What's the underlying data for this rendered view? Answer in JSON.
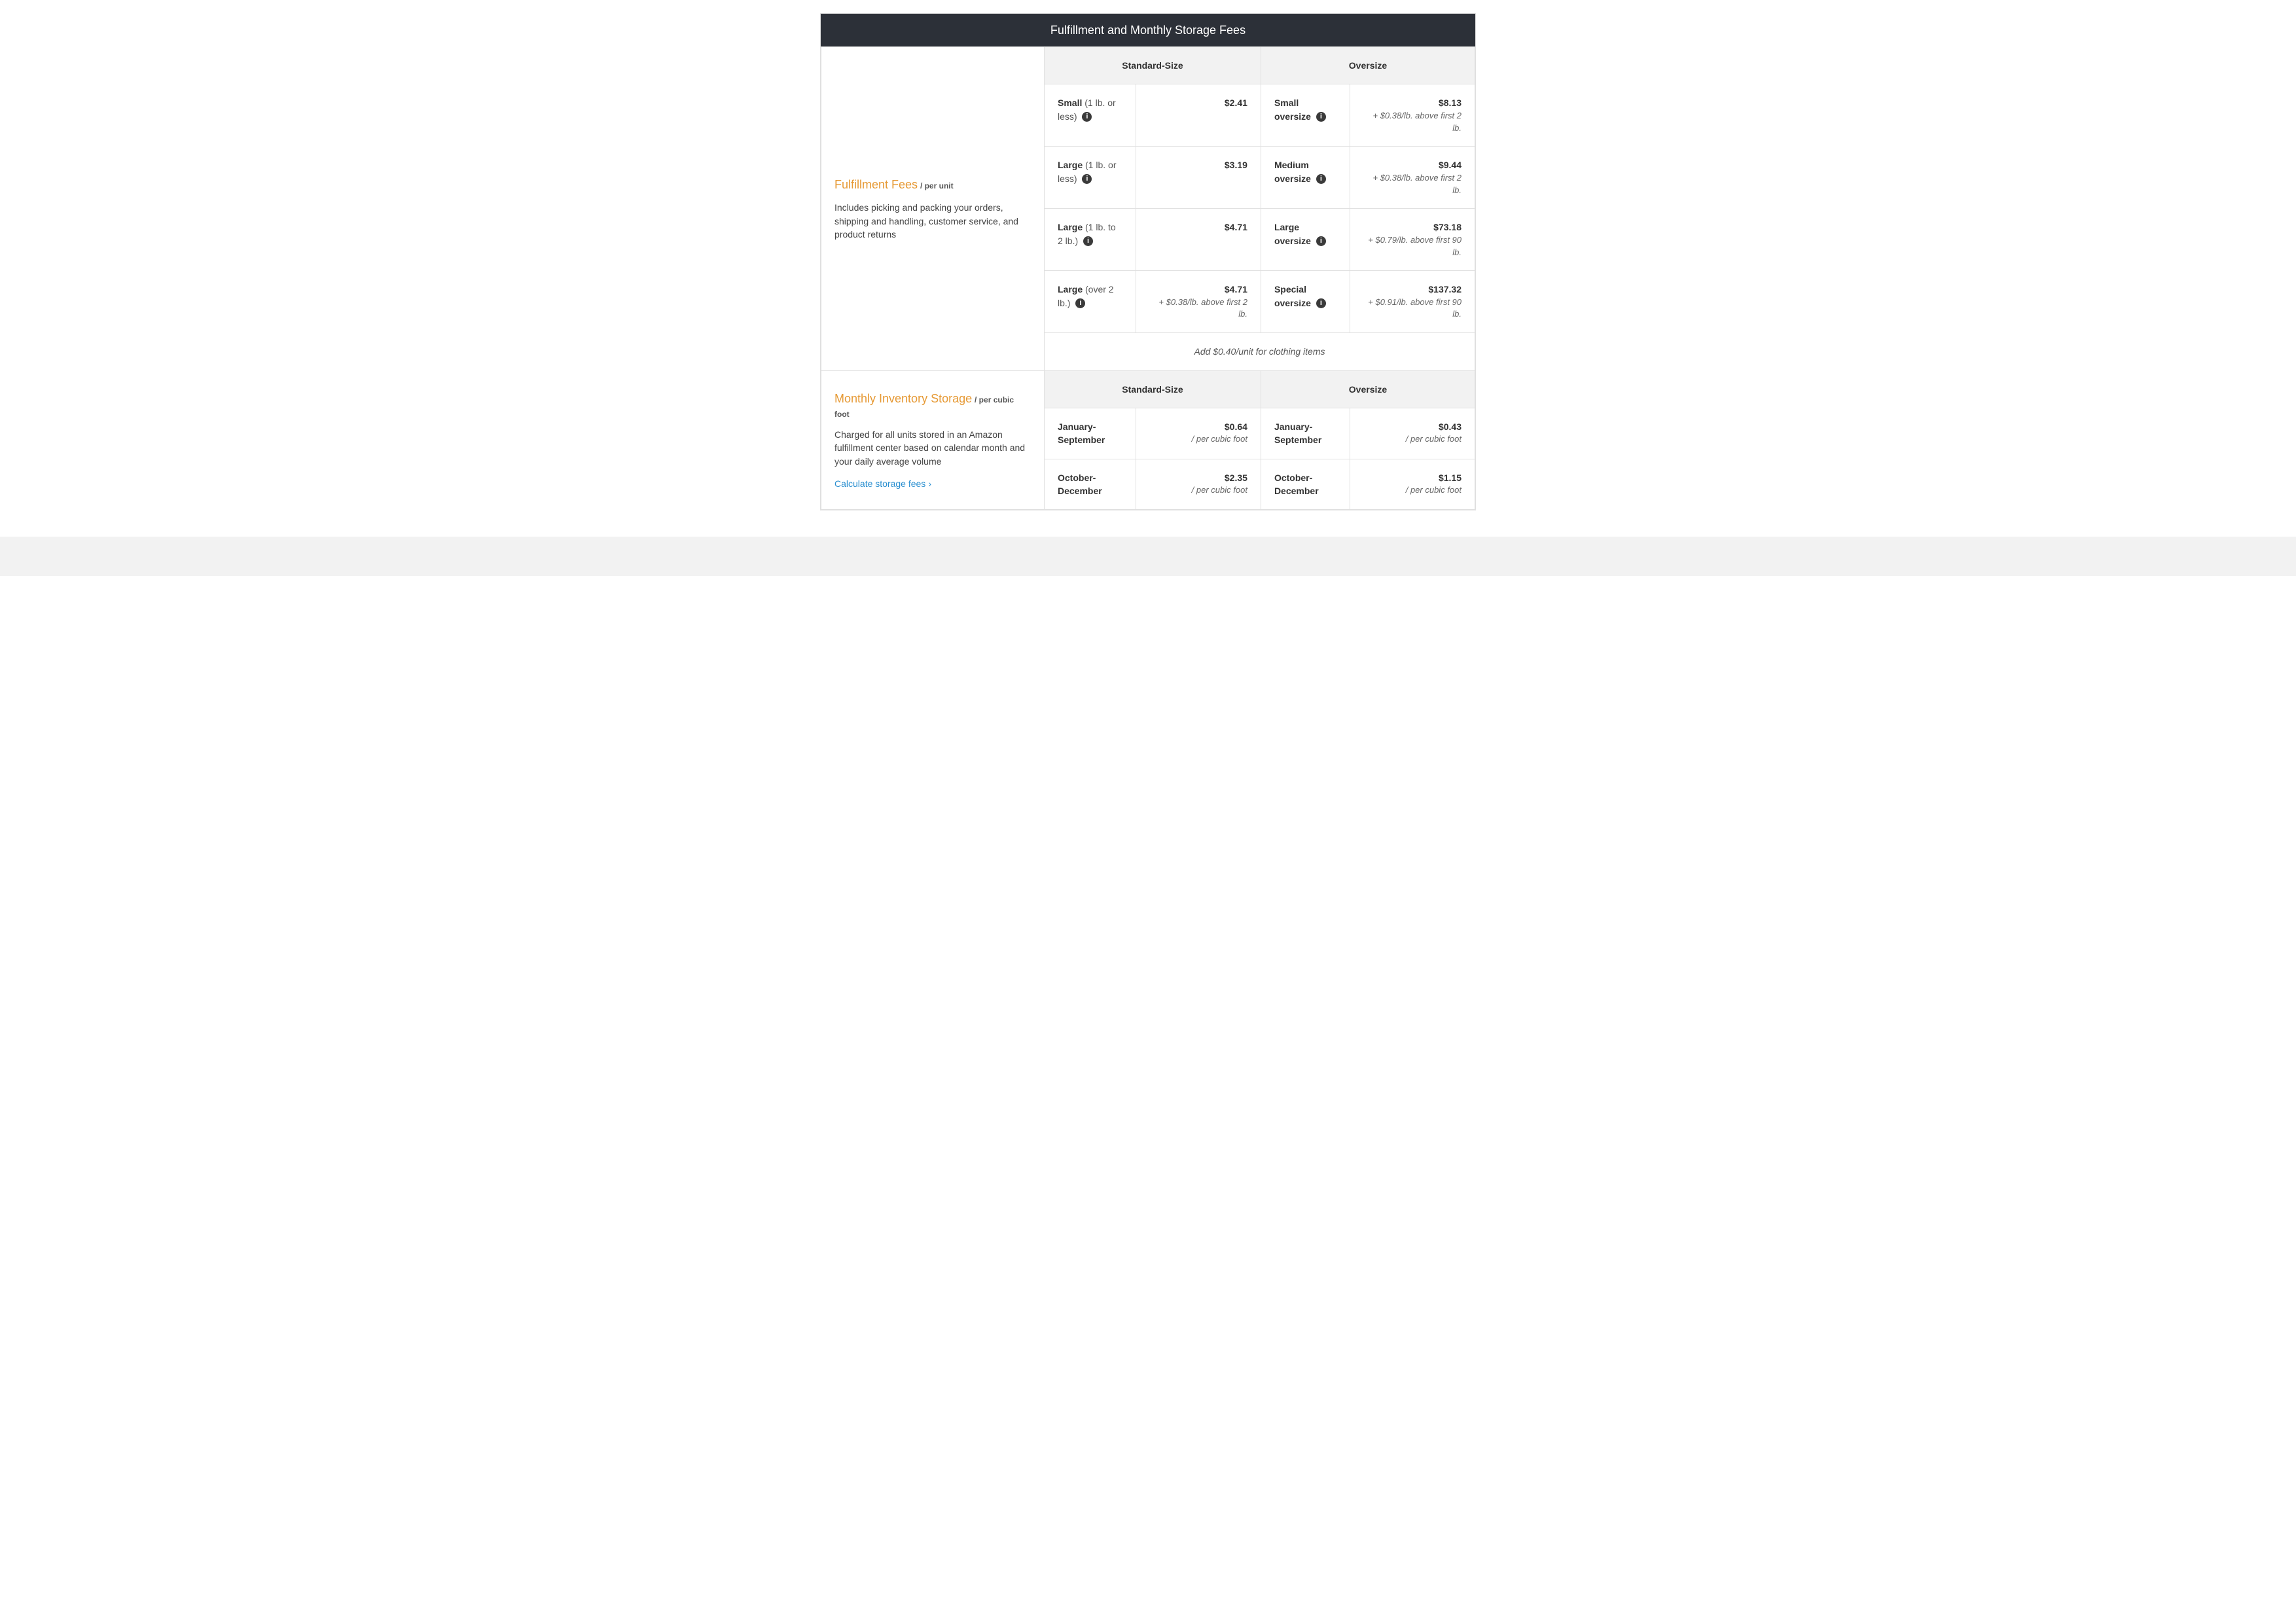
{
  "title": "Fulfillment and Monthly Storage Fees",
  "fulfillment": {
    "section_title": "Fulfillment Fees",
    "unit_label": "/ per unit",
    "description": "Includes picking and packing your orders, shipping and handling, customer service, and product returns",
    "headers": {
      "standard": "Standard-Size",
      "oversize": "Oversize"
    },
    "standard": [
      {
        "name": "Small",
        "paren": "(1 lb. or less)",
        "price": "$2.41",
        "extra": ""
      },
      {
        "name": "Large",
        "paren": "(1 lb. or less)",
        "price": "$3.19",
        "extra": ""
      },
      {
        "name": "Large",
        "paren": "(1 lb. to 2 lb.)",
        "price": "$4.71",
        "extra": ""
      },
      {
        "name": "Large",
        "paren": "(over 2 lb.)",
        "price": "$4.71",
        "extra": "+ $0.38/lb. above first 2 lb."
      }
    ],
    "oversize": [
      {
        "name": "Small oversize",
        "price": "$8.13",
        "extra": "+ $0.38/lb. above first 2 lb."
      },
      {
        "name": "Medium oversize",
        "price": "$9.44",
        "extra": "+ $0.38/lb. above first 2 lb."
      },
      {
        "name": "Large oversize",
        "price": "$73.18",
        "extra": "+ $0.79/lb. above first 90 lb."
      },
      {
        "name": "Special oversize",
        "price": "$137.32",
        "extra": "+ $0.91/lb. above first 90 lb."
      }
    ],
    "note": "Add $0.40/unit for clothing items"
  },
  "storage": {
    "section_title": "Monthly Inventory Storage",
    "unit_label": "/ per cubic foot",
    "description": "Charged for all units stored in an Amazon fulfillment center based on calendar month and your daily average volume",
    "link_label": "Calculate storage fees",
    "headers": {
      "standard": "Standard-Size",
      "oversize": "Oversize"
    },
    "per_label": "/ per cubic foot",
    "rows": [
      {
        "period": "January-September",
        "standard": "$0.64",
        "oversize": "$0.43"
      },
      {
        "period": "October-December",
        "standard": "$2.35",
        "oversize": "$1.15"
      }
    ]
  }
}
